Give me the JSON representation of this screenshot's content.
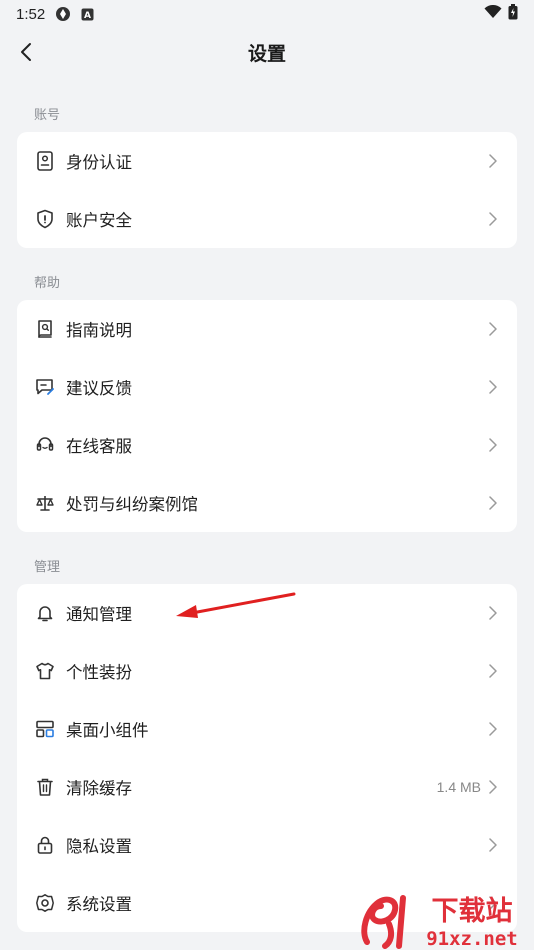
{
  "status_bar": {
    "time": "1:52"
  },
  "header": {
    "title": "设置"
  },
  "sections": [
    {
      "label": "账号",
      "items": [
        {
          "label": "身份认证",
          "icon": "id-card-icon",
          "value": ""
        },
        {
          "label": "账户安全",
          "icon": "shield-icon",
          "value": ""
        }
      ]
    },
    {
      "label": "帮助",
      "items": [
        {
          "label": "指南说明",
          "icon": "guide-book-icon",
          "value": ""
        },
        {
          "label": "建议反馈",
          "icon": "feedback-icon",
          "value": ""
        },
        {
          "label": "在线客服",
          "icon": "headset-icon",
          "value": ""
        },
        {
          "label": "处罚与纠纷案例馆",
          "icon": "scale-icon",
          "value": ""
        }
      ]
    },
    {
      "label": "管理",
      "items": [
        {
          "label": "通知管理",
          "icon": "bell-icon",
          "value": ""
        },
        {
          "label": "个性装扮",
          "icon": "tshirt-icon",
          "value": ""
        },
        {
          "label": "桌面小组件",
          "icon": "widget-icon",
          "value": ""
        },
        {
          "label": "清除缓存",
          "icon": "trash-icon",
          "value": "1.4 MB"
        },
        {
          "label": "隐私设置",
          "icon": "lock-icon",
          "value": ""
        },
        {
          "label": "系统设置",
          "icon": "gear-icon",
          "value": ""
        }
      ]
    }
  ],
  "watermark": {
    "text": "下载站",
    "domain": "91xz.net"
  },
  "colors": {
    "background": "#f2f3f5",
    "card": "#ffffff",
    "annotation_arrow": "#e02020",
    "watermark": "#e0303a"
  }
}
